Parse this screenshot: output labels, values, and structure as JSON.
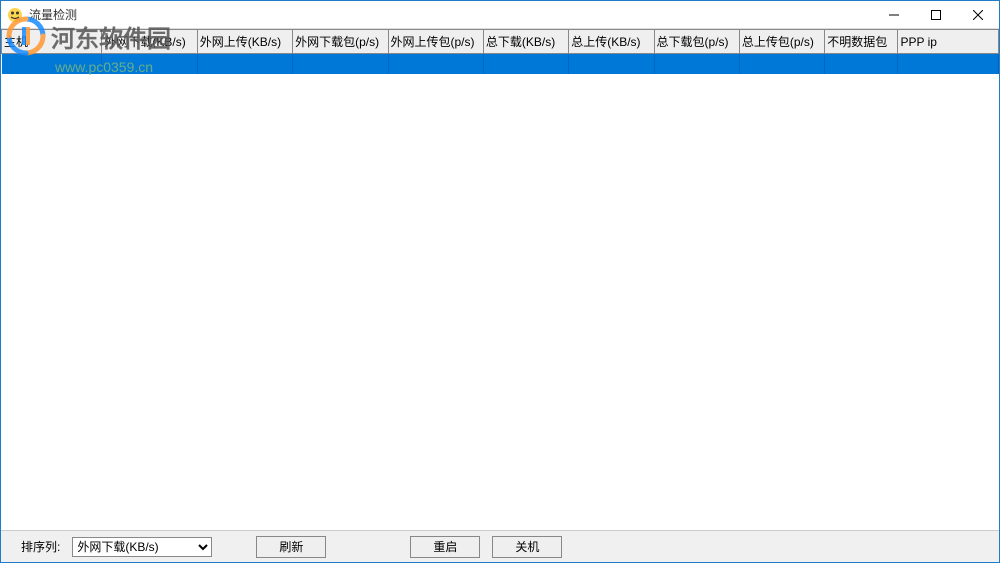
{
  "window": {
    "title": "流量检测"
  },
  "table": {
    "columns": [
      "主机",
      "外网下载(KB/s)",
      "外网上传(KB/s)",
      "外网下载包(p/s)",
      "外网上传包(p/s)",
      "总下载(KB/s)",
      "总上传(KB/s)",
      "总下载包(p/s)",
      "总上传包(p/s)",
      "不明数据包",
      "PPP ip"
    ],
    "rows": [
      {
        "selected": true,
        "cells": [
          "",
          "",
          "",
          "",
          "",
          "",
          "",
          "",
          "",
          "",
          ""
        ]
      }
    ]
  },
  "bottombar": {
    "sort_label": "排序列:",
    "sort_value": "外网下载(KB/s)",
    "refresh_label": "刷新",
    "restart_label": "重启",
    "shutdown_label": "关机"
  },
  "watermark": {
    "text": "河东软件园",
    "url": "www.pc0359.cn"
  }
}
